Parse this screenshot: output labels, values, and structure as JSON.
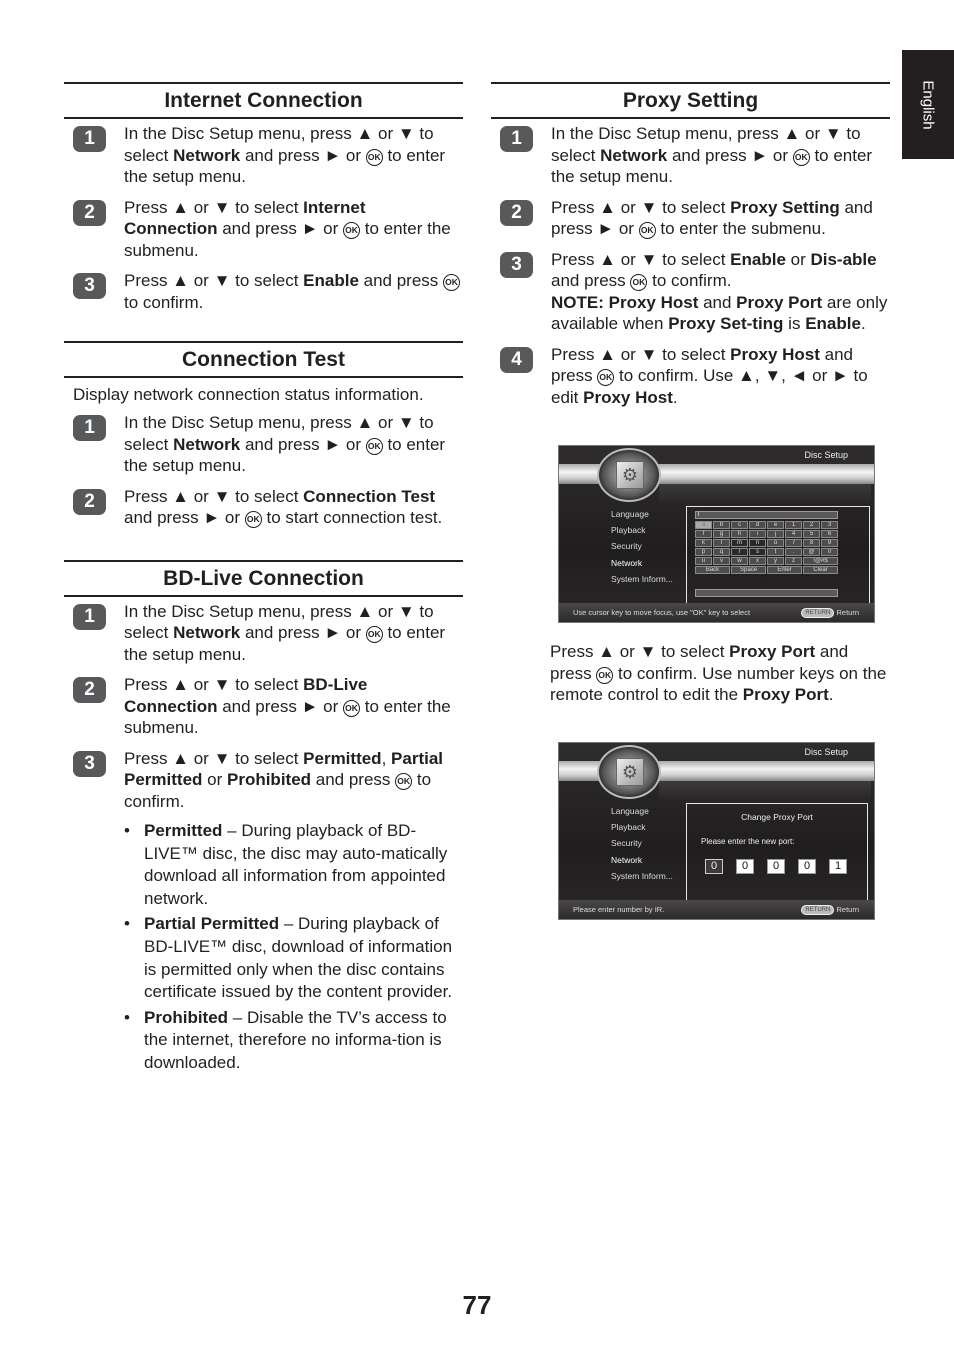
{
  "side_tab": "English",
  "page_number": "77",
  "ok_glyph": "OK",
  "internet_connection": {
    "title": "Internet Connection",
    "steps": [
      {
        "num": "1",
        "parts": [
          "In the Disc Setup menu, press ▲ or ▼ to select ",
          "Network",
          " and press ► or ",
          " to enter the setup menu."
        ]
      },
      {
        "num": "2",
        "parts": [
          "Press ▲ or ▼ to select ",
          "Internet Connection",
          " and press ► or ",
          " to enter the submenu."
        ]
      },
      {
        "num": "3",
        "parts": [
          "Press ▲ or ▼ to select ",
          "Enable",
          " and press ",
          " to confirm."
        ]
      }
    ]
  },
  "connection_test": {
    "title": "Connection Test",
    "intro": "Display network connection status information.",
    "steps": [
      {
        "num": "1",
        "parts": [
          "In the Disc Setup menu, press ▲ or ▼ to select ",
          "Network",
          " and press ► or ",
          " to enter the setup menu."
        ]
      },
      {
        "num": "2",
        "parts": [
          "Press ▲ or ▼ to select ",
          "Connection Test",
          " and press ► or ",
          " to start connection test."
        ]
      }
    ]
  },
  "bdlive_connection": {
    "title": "BD-Live Connection",
    "steps": [
      {
        "num": "1",
        "parts": [
          "In the Disc Setup menu, press ▲ or ▼ to select ",
          "Network",
          " and press ► or ",
          " to enter the setup menu."
        ]
      },
      {
        "num": "2",
        "parts": [
          "Press ▲ or ▼ to select ",
          "BD-Live Connection",
          " and press ► or ",
          " to enter the submenu."
        ]
      },
      {
        "num": "3",
        "parts": [
          "Press ▲ or ▼ to select ",
          "Permitted",
          ", ",
          "Partial Permitted",
          " or ",
          "Prohibited",
          " and press ",
          " to confirm."
        ]
      }
    ],
    "options": [
      {
        "term": "Permitted",
        "desc": " – During playback of BD-LIVE™ disc, the disc may auto-matically download all information from appointed network."
      },
      {
        "term": "Partial Permitted",
        "desc": " – During playback of BD-LIVE™ disc, download of information is permitted only when the disc contains certificate issued by the content provider."
      },
      {
        "term": "Prohibited",
        "desc": " – Disable the TV’s access to the internet, therefore no informa-tion is downloaded."
      }
    ]
  },
  "proxy_setting": {
    "title": "Proxy Setting",
    "steps": [
      {
        "num": "1",
        "parts": [
          "In the Disc Setup menu, press ▲ or ▼ to select ",
          "Network",
          " and press ► or ",
          " to enter the setup menu."
        ]
      },
      {
        "num": "2",
        "parts": [
          "Press ▲ or ▼ to select ",
          "Proxy Setting",
          " and press ► or ",
          " to enter the submenu."
        ]
      },
      {
        "num": "3",
        "parts": [
          "Press ▲ or ▼ to select ",
          "Enable",
          " or ",
          "Dis-able",
          " and press ",
          " to confirm."
        ],
        "note": {
          "label": "NOTE:",
          "parts": [
            "Proxy Host",
            " and ",
            "Proxy Port",
            " are only available when ",
            "Proxy Set-ting",
            " is ",
            "Enable",
            "."
          ]
        }
      },
      {
        "num": "4",
        "parts": [
          "Press ▲ or ▼ to select ",
          "Proxy Host",
          " and press ",
          " to confirm. Use ▲, ▼, ◄ or ► to edit ",
          "Proxy Host",
          "."
        ]
      }
    ],
    "port_step": {
      "parts": [
        "Press ▲ or ▼ to select ",
        "Proxy Port",
        " and press ",
        " to confirm. Use number keys on the remote control to edit the ",
        "Proxy Port",
        "."
      ]
    }
  },
  "screen_host": {
    "title": "Disc Setup",
    "menu": [
      "Language",
      "Playback",
      "Security",
      "Network",
      "System Inform..."
    ],
    "active_menu": "Network",
    "input_value": "l",
    "keys": [
      [
        "a",
        "b",
        "c",
        "d",
        "e",
        "1",
        "2",
        "3"
      ],
      [
        "f",
        "g",
        "h",
        "i",
        "j",
        "4",
        "5",
        "6"
      ],
      [
        "k",
        "l",
        "m",
        "n",
        "o",
        "7",
        "8",
        "9"
      ],
      [
        "p",
        "q",
        "r",
        "s",
        "t",
        ".",
        "@",
        "0"
      ],
      [
        "u",
        "v",
        "w",
        "x",
        "y",
        "z",
        "!@#$"
      ],
      [
        "Back",
        "Space",
        "Enter",
        "Clear"
      ]
    ],
    "selected_key": "a",
    "footer_hint": "Use cursor key to move focus, use \"OK\" key to select",
    "return_pill": "RETURN",
    "return_label": "Return"
  },
  "screen_port": {
    "title": "Disc Setup",
    "menu": [
      "Language",
      "Playback",
      "Security",
      "Network",
      "System Inform..."
    ],
    "active_menu": "Network",
    "dialog_title": "Change Proxy Port",
    "prompt": "Please enter the new port:",
    "digits": [
      "0",
      "0",
      "0",
      "0",
      "1"
    ],
    "footer_hint": "Please enter number by IR.",
    "return_pill": "RETURN",
    "return_label": "Return"
  }
}
